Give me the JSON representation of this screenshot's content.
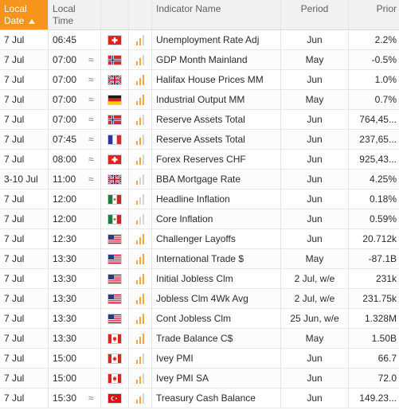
{
  "headers": {
    "date_line1": "Local",
    "date_line2": "Date",
    "time_line1": "Local",
    "time_line2": "Time",
    "name": "Indicator Name",
    "period": "Period",
    "prior": "Prior"
  },
  "colors": {
    "accent": "#f6941c",
    "importance_on": "#f6a540",
    "importance_off": "#d5d5d5"
  },
  "rows": [
    {
      "date": "7 Jul",
      "time": "06:45",
      "approx": "",
      "flag": "CH",
      "importance": 2,
      "name": "Unemployment Rate Adj",
      "period": "Jun",
      "prior": "2.2%"
    },
    {
      "date": "7 Jul",
      "time": "07:00",
      "approx": "≈",
      "flag": "NO",
      "importance": 2,
      "name": "GDP Month Mainland",
      "period": "May",
      "prior": "-0.5%"
    },
    {
      "date": "7 Jul",
      "time": "07:00",
      "approx": "≈",
      "flag": "GB",
      "importance": 3,
      "name": "Halifax House Prices MM",
      "period": "Jun",
      "prior": "1.0%"
    },
    {
      "date": "7 Jul",
      "time": "07:00",
      "approx": "≈",
      "flag": "DE",
      "importance": 3,
      "name": "Industrial Output MM",
      "period": "May",
      "prior": "0.7%"
    },
    {
      "date": "7 Jul",
      "time": "07:00",
      "approx": "≈",
      "flag": "NO",
      "importance": 2,
      "name": "Reserve Assets Total",
      "period": "Jun",
      "prior": "764,45..."
    },
    {
      "date": "7 Jul",
      "time": "07:45",
      "approx": "≈",
      "flag": "FR",
      "importance": 2,
      "name": "Reserve Assets Total",
      "period": "Jun",
      "prior": "237,65..."
    },
    {
      "date": "7 Jul",
      "time": "08:00",
      "approx": "≈",
      "flag": "CH",
      "importance": 2,
      "name": "Forex Reserves CHF",
      "period": "Jun",
      "prior": "925,43..."
    },
    {
      "date": "3-10 Jul",
      "time": "11:00",
      "approx": "≈",
      "flag": "GB",
      "importance": 1,
      "name": "BBA Mortgage Rate",
      "period": "Jun",
      "prior": "4.25%"
    },
    {
      "date": "7 Jul",
      "time": "12:00",
      "approx": "",
      "flag": "MX",
      "importance": 1,
      "name": "Headline Inflation",
      "period": "Jun",
      "prior": "0.18%"
    },
    {
      "date": "7 Jul",
      "time": "12:00",
      "approx": "",
      "flag": "MX",
      "importance": 1,
      "name": "Core Inflation",
      "period": "Jun",
      "prior": "0.59%"
    },
    {
      "date": "7 Jul",
      "time": "12:30",
      "approx": "",
      "flag": "US",
      "importance": 3,
      "name": "Challenger Layoffs",
      "period": "Jun",
      "prior": "20.712k"
    },
    {
      "date": "7 Jul",
      "time": "13:30",
      "approx": "",
      "flag": "US",
      "importance": 3,
      "name": "International Trade $",
      "period": "May",
      "prior": "-87.1B"
    },
    {
      "date": "7 Jul",
      "time": "13:30",
      "approx": "",
      "flag": "US",
      "importance": 3,
      "name": "Initial Jobless Clm",
      "period": "2 Jul, w/e",
      "prior": "231k"
    },
    {
      "date": "7 Jul",
      "time": "13:30",
      "approx": "",
      "flag": "US",
      "importance": 3,
      "name": "Jobless Clm 4Wk Avg",
      "period": "2 Jul, w/e",
      "prior": "231.75k"
    },
    {
      "date": "7 Jul",
      "time": "13:30",
      "approx": "",
      "flag": "US",
      "importance": 3,
      "name": "Cont Jobless Clm",
      "period": "25 Jun, w/e",
      "prior": "1.328M"
    },
    {
      "date": "7 Jul",
      "time": "13:30",
      "approx": "",
      "flag": "CA",
      "importance": 3,
      "name": "Trade Balance C$",
      "period": "May",
      "prior": "1.50B"
    },
    {
      "date": "7 Jul",
      "time": "15:00",
      "approx": "",
      "flag": "CA",
      "importance": 2,
      "name": "Ivey PMI",
      "period": "Jun",
      "prior": "66.7"
    },
    {
      "date": "7 Jul",
      "time": "15:00",
      "approx": "",
      "flag": "CA",
      "importance": 2,
      "name": "Ivey PMI SA",
      "period": "Jun",
      "prior": "72.0"
    },
    {
      "date": "7 Jul",
      "time": "15:30",
      "approx": "≈",
      "flag": "TR",
      "importance": 2,
      "name": "Treasury Cash Balance",
      "period": "Jun",
      "prior": "149.23..."
    }
  ]
}
